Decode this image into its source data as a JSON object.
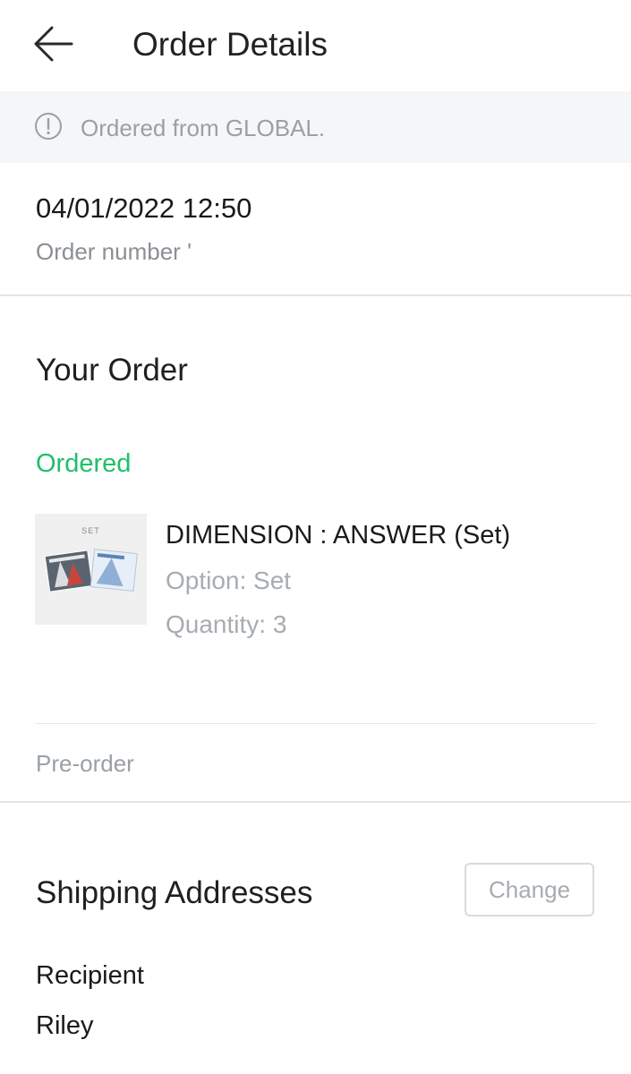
{
  "header": {
    "title": "Order Details",
    "back_icon": "arrow-left-icon"
  },
  "notice": {
    "icon": "info-circle-icon",
    "text": "Ordered from GLOBAL."
  },
  "order": {
    "datetime": "04/01/2022 12:50",
    "number_label": "Order number '"
  },
  "your_order": {
    "title": "Your Order",
    "status": "Ordered",
    "status_color": "#1fbf6a",
    "item": {
      "thumb_label": "SET",
      "name": "DIMENSION : ANSWER (Set)",
      "option": "Option: Set",
      "quantity": "Quantity: 3"
    },
    "preorder_label": "Pre-order"
  },
  "shipping": {
    "title": "Shipping Addresses",
    "change_label": "Change",
    "recipient_label": "Recipient",
    "recipient_name": "Riley"
  }
}
